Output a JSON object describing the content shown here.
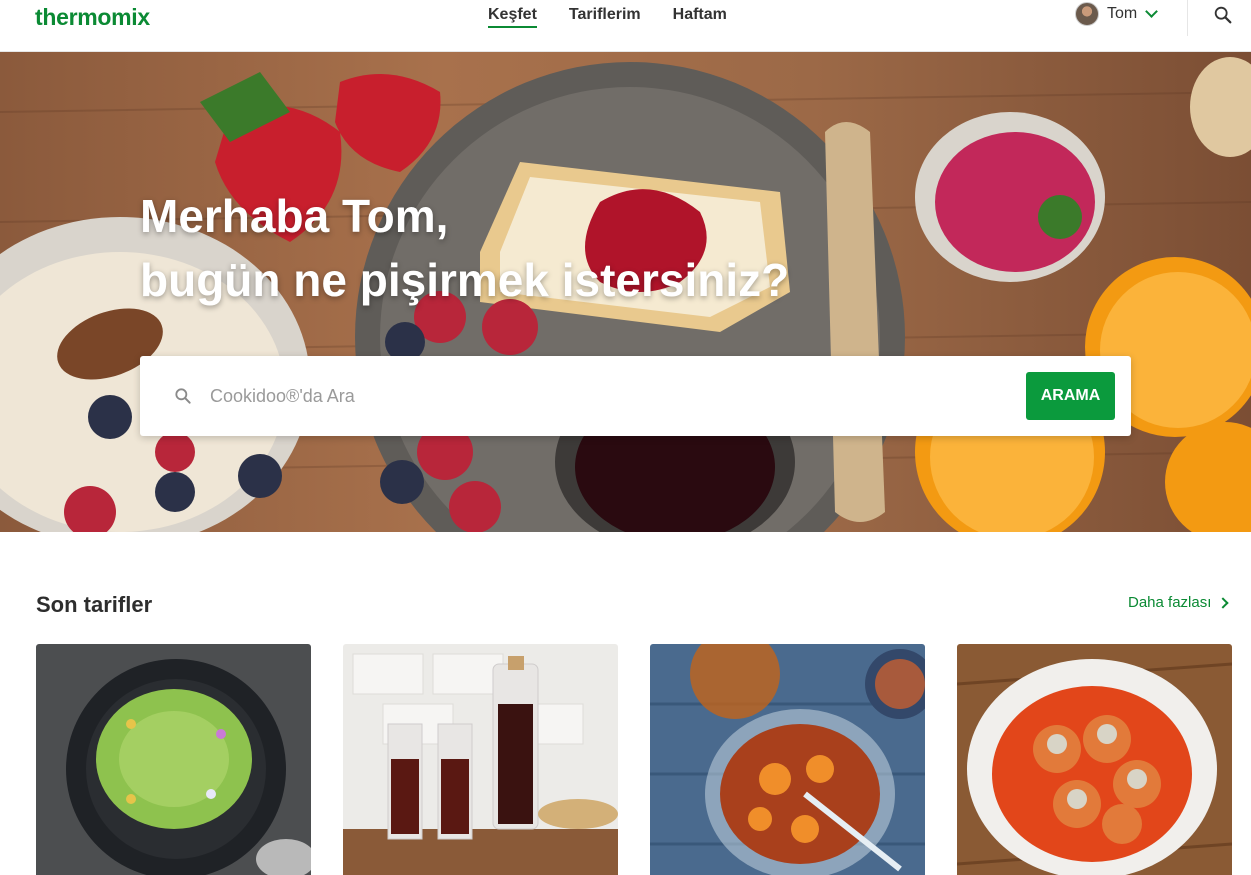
{
  "header": {
    "logo": "thermomix",
    "nav": [
      {
        "label": "Keşfet",
        "active": true
      },
      {
        "label": "Tariflerim",
        "active": false
      },
      {
        "label": "Haftam",
        "active": false
      }
    ],
    "user": {
      "name": "Tom"
    },
    "icons": {
      "user_menu": "chevron-down-icon",
      "search": "search-icon"
    }
  },
  "hero": {
    "title_line1": "Merhaba Tom,",
    "title_line2": "bugün ne pişirmek istersiniz?",
    "search": {
      "placeholder": "Cookidoo®'da Ara",
      "button_label": "ARAMA"
    }
  },
  "recent": {
    "title": "Son tarifler",
    "more_label": "Daha fazlası",
    "cards": [
      {
        "image": "green-pea-puree-bowl"
      },
      {
        "image": "dark-syrup-bottle-glasses"
      },
      {
        "image": "fruit-compote-glass-bowl"
      },
      {
        "image": "meatballs-tomato-sauce"
      }
    ]
  },
  "colors": {
    "brand_green": "#0b8a34",
    "button_green": "#0b9a3d"
  }
}
